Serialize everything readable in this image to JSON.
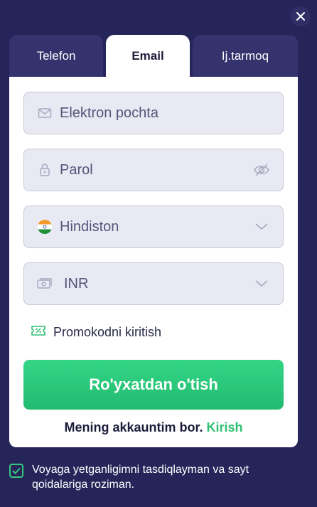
{
  "tabs": [
    {
      "label": "Telefon",
      "active": false
    },
    {
      "label": "Email",
      "active": true
    },
    {
      "label": "Ij.tarmoq",
      "active": false
    }
  ],
  "fields": {
    "email": {
      "placeholder": "Elektron pochta",
      "icon": "envelope-icon"
    },
    "password": {
      "placeholder": "Parol",
      "icon": "lock-icon",
      "toggle_icon": "eye-off-icon"
    },
    "country": {
      "value": "Hindiston",
      "icon": "india-flag-icon"
    },
    "currency": {
      "value": "INR",
      "icon": "money-icon"
    }
  },
  "promo": {
    "label": "Promokodni kiritish",
    "icon": "promo-ticket-icon"
  },
  "submit_label": "Ro'yxatdan o'tish",
  "login": {
    "text": "Mening akkauntim bor.",
    "link": "Kirish"
  },
  "consent": {
    "text": "Voyaga yetganligimni tasdiqlayman va sayt qoidalariga roziman.",
    "checked": true
  },
  "colors": {
    "background": "#26255a",
    "accent": "#2ec073",
    "tab_inactive": "#34336e"
  }
}
